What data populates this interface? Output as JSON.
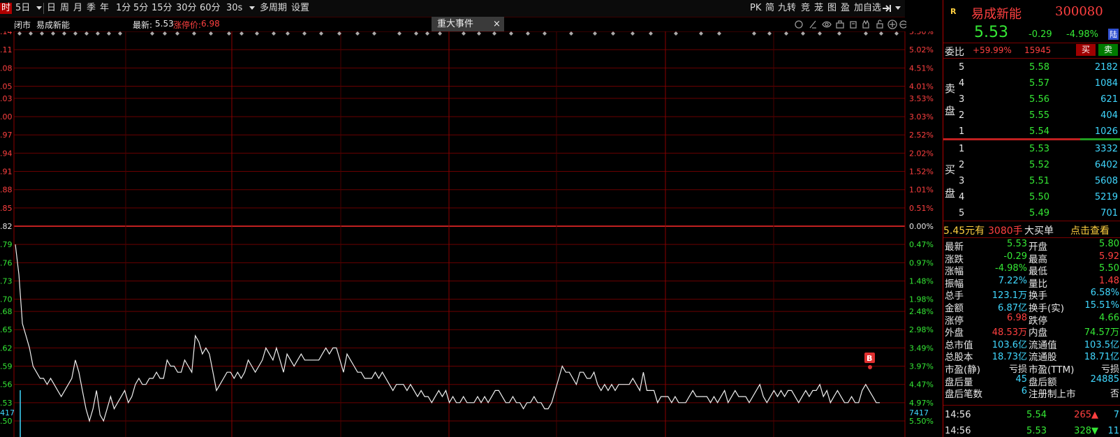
{
  "toolbar": {
    "items": [
      "时",
      "5日",
      "日",
      "周",
      "月",
      "季",
      "年",
      "1分",
      "5分",
      "15分",
      "30分",
      "60分",
      "30s",
      "多周期",
      "设置"
    ],
    "right_items": [
      "PK",
      "简",
      "九转",
      "竞",
      "茏",
      "图",
      "盈",
      "加自选"
    ]
  },
  "infobar": {
    "status": "闭市",
    "stock_name": "易成新能",
    "latest_label": "最新:",
    "latest_value": "5.53",
    "limit_up_label": "涨停价:",
    "limit_up_value": "6.98"
  },
  "event_tag": {
    "label": "重大事件",
    "close": "×"
  },
  "chart_data": {
    "type": "line",
    "x_label": "",
    "y_label": "",
    "y_range": [
      5.5,
      6.14
    ],
    "prev_close": 5.82,
    "left_ticks": [
      ".14",
      ".11",
      ".08",
      ".05",
      ".03",
      ".00",
      ".97",
      ".94",
      ".91",
      ".88",
      ".85",
      ".82",
      ".79",
      ".76",
      ".73",
      ".70",
      ".68",
      ".65",
      ".62",
      ".59",
      ".56",
      ".53",
      ".50"
    ],
    "left_tick_values": [
      6.14,
      6.11,
      6.08,
      6.05,
      6.03,
      6.0,
      5.97,
      5.94,
      5.91,
      5.88,
      5.85,
      5.82,
      5.79,
      5.76,
      5.73,
      5.7,
      5.68,
      5.65,
      5.62,
      5.59,
      5.56,
      5.53,
      5.5
    ],
    "right_ticks": [
      "5.50%",
      "5.02%",
      "4.51%",
      "4.01%",
      "3.53%",
      "3.03%",
      "2.52%",
      "2.02%",
      "1.52%",
      "1.01%",
      "0.51%",
      "0.00%",
      "0.47%",
      "0.97%",
      "1.48%",
      "1.98%",
      "2.48%",
      "2.98%",
      "3.49%",
      "3.97%",
      "4.47%",
      "4.97%",
      "5.50%"
    ],
    "volume_left": "417",
    "volume_right": "7417",
    "marker": "B",
    "prices": [
      5.79,
      5.74,
      5.66,
      5.64,
      5.62,
      5.59,
      5.58,
      5.57,
      5.57,
      5.56,
      5.57,
      5.56,
      5.55,
      5.54,
      5.55,
      5.56,
      5.57,
      5.6,
      5.58,
      5.55,
      5.52,
      5.5,
      5.52,
      5.55,
      5.51,
      5.5,
      5.52,
      5.54,
      5.52,
      5.53,
      5.54,
      5.55,
      5.53,
      5.54,
      5.56,
      5.57,
      5.56,
      5.56,
      5.57,
      5.57,
      5.58,
      5.57,
      5.57,
      5.6,
      5.59,
      5.59,
      5.58,
      5.58,
      5.6,
      5.59,
      5.58,
      5.64,
      5.63,
      5.61,
      5.62,
      5.61,
      5.58,
      5.55,
      5.56,
      5.57,
      5.58,
      5.58,
      5.57,
      5.58,
      5.57,
      5.58,
      5.6,
      5.59,
      5.58,
      5.59,
      5.6,
      5.62,
      5.61,
      5.6,
      5.62,
      5.6,
      5.58,
      5.61,
      5.6,
      5.59,
      5.6,
      5.61,
      5.6,
      5.6,
      5.6,
      5.6,
      5.6,
      5.61,
      5.62,
      5.61,
      5.62,
      5.62,
      5.6,
      5.58,
      5.61,
      5.6,
      5.59,
      5.58,
      5.58,
      5.57,
      5.57,
      5.57,
      5.58,
      5.57,
      5.58,
      5.57,
      5.56,
      5.55,
      5.56,
      5.56,
      5.56,
      5.55,
      5.56,
      5.55,
      5.54,
      5.55,
      5.54,
      5.54,
      5.53,
      5.54,
      5.55,
      5.54,
      5.55,
      5.53,
      5.54,
      5.53,
      5.53,
      5.54,
      5.53,
      5.53,
      5.53,
      5.54,
      5.53,
      5.54,
      5.53,
      5.54,
      5.55,
      5.55,
      5.54,
      5.53,
      5.53,
      5.54,
      5.53,
      5.53,
      5.52,
      5.53,
      5.53,
      5.54,
      5.53,
      5.53,
      5.52,
      5.52,
      5.53,
      5.55,
      5.57,
      5.59,
      5.58,
      5.58,
      5.57,
      5.56,
      5.58,
      5.58,
      5.57,
      5.57,
      5.58,
      5.56,
      5.55,
      5.56,
      5.55,
      5.56,
      5.55,
      5.56,
      5.56,
      5.56,
      5.56,
      5.57,
      5.56,
      5.55,
      5.58,
      5.55,
      5.55,
      5.55,
      5.53,
      5.54,
      5.54,
      5.54,
      5.53,
      5.54,
      5.53,
      5.53,
      5.53,
      5.54,
      5.55,
      5.54,
      5.54,
      5.54,
      5.54,
      5.53,
      5.54,
      5.53,
      5.54,
      5.55,
      5.53,
      5.54,
      5.55,
      5.54,
      5.54,
      5.54,
      5.53,
      5.54,
      5.55,
      5.56,
      5.54,
      5.53,
      5.54,
      5.55,
      5.54,
      5.55,
      5.54,
      5.55,
      5.55,
      5.54,
      5.53,
      5.54,
      5.55,
      5.54,
      5.55,
      5.55,
      5.56,
      5.54,
      5.55,
      5.53,
      5.54,
      5.55,
      5.54,
      5.53,
      5.53,
      5.54,
      5.53,
      5.53,
      5.55,
      5.56,
      5.55,
      5.54,
      5.53,
      5.53
    ]
  },
  "right_panel": {
    "badge": "R",
    "stock_name": "易成新能",
    "stock_code": "300080",
    "price": "5.53",
    "change": "-0.29",
    "change_pct": "-4.98%",
    "market_tag": "陆",
    "weibi_label": "委比",
    "weibi_value": "+59.99%",
    "weicha_value": "15945",
    "buy_btn": "买",
    "sell_btn": "卖",
    "sell_label_1": "卖",
    "sell_label_2": "盘",
    "buy_label_1": "买",
    "buy_label_2": "盘",
    "asks": [
      {
        "level": "5",
        "price": "5.58",
        "volume": "2182"
      },
      {
        "level": "4",
        "price": "5.57",
        "volume": "1084"
      },
      {
        "level": "3",
        "price": "5.56",
        "volume": "621"
      },
      {
        "level": "2",
        "price": "5.55",
        "volume": "404"
      },
      {
        "level": "1",
        "price": "5.54",
        "volume": "1026"
      }
    ],
    "bids": [
      {
        "level": "1",
        "price": "5.53",
        "volume": "3332"
      },
      {
        "level": "2",
        "price": "5.52",
        "volume": "6402"
      },
      {
        "level": "3",
        "price": "5.51",
        "volume": "5608"
      },
      {
        "level": "4",
        "price": "5.50",
        "volume": "5219"
      },
      {
        "level": "5",
        "price": "5.49",
        "volume": "701"
      }
    ],
    "big_order": {
      "price": "5.45元有",
      "volume": "3080手",
      "label": "大买单",
      "link": "点击查看"
    },
    "stats": [
      {
        "l1": "最新",
        "v1": "5.53",
        "c1": "green",
        "l2": "开盘",
        "v2": "5.80",
        "c2": "green"
      },
      {
        "l1": "涨跌",
        "v1": "-0.29",
        "c1": "green",
        "l2": "最高",
        "v2": "5.92",
        "c2": "red"
      },
      {
        "l1": "涨幅",
        "v1": "-4.98%",
        "c1": "green",
        "l2": "最低",
        "v2": "5.50",
        "c2": "green"
      },
      {
        "l1": "振幅",
        "v1": "7.22%",
        "c1": "cyan",
        "l2": "量比",
        "v2": "1.48",
        "c2": "red"
      },
      {
        "l1": "总手",
        "v1": "123.1万",
        "c1": "cyan",
        "l2": "换手",
        "v2": "6.58%",
        "c2": "cyan"
      },
      {
        "l1": "金额",
        "v1": "6.87亿",
        "c1": "cyan",
        "l2": "换手(实)",
        "v2": "15.51%",
        "c2": "cyan"
      },
      {
        "l1": "涨停",
        "v1": "6.98",
        "c1": "red",
        "l2": "跌停",
        "v2": "4.66",
        "c2": "green"
      },
      {
        "l1": "外盘",
        "v1": "48.53万",
        "c1": "red",
        "l2": "内盘",
        "v2": "74.57万",
        "c2": "green"
      },
      {
        "l1": "总市值",
        "v1": "103.6亿",
        "c1": "cyan",
        "l2": "流通值",
        "v2": "103.5亿",
        "c2": "cyan"
      },
      {
        "l1": "总股本",
        "v1": "18.73亿",
        "c1": "cyan",
        "l2": "流通股",
        "v2": "18.71亿",
        "c2": "cyan"
      },
      {
        "l1": "市盈(静)",
        "v1": "亏损",
        "c1": "white",
        "l2": "市盈(TTM)",
        "v2": "亏损",
        "c2": "white"
      },
      {
        "l1": "盘后量",
        "v1": "45",
        "c1": "cyan",
        "l2": "盘后额",
        "v2": "24885",
        "c2": "cyan"
      },
      {
        "l1": "盘后笔数",
        "v1": "6",
        "c1": "cyan",
        "l2": "注册制上市",
        "v2": "否",
        "c2": "white"
      }
    ],
    "ticks": [
      {
        "time": "14:56",
        "price": "5.54",
        "volume": "265",
        "dir": "up",
        "count": "7"
      },
      {
        "time": "14:56",
        "price": "5.53",
        "volume": "328",
        "dir": "down",
        "count": "11"
      }
    ]
  },
  "colors": {
    "up": "#ff4040",
    "down": "#35e835",
    "grid": "#7a0000",
    "accent": "#b00000"
  }
}
